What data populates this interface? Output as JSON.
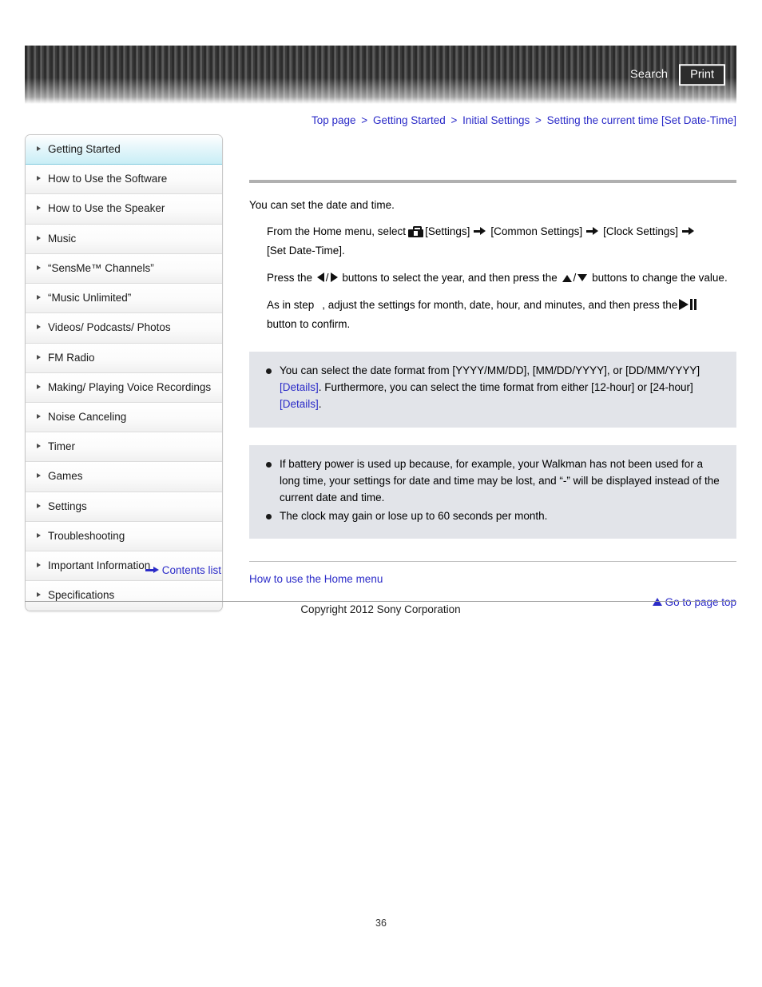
{
  "header": {
    "search_label": "Search",
    "print_label": "Print"
  },
  "breadcrumb": {
    "separator": ">",
    "items": [
      {
        "label": "Top page"
      },
      {
        "label": "Getting Started"
      },
      {
        "label": "Initial Settings"
      },
      {
        "label": "Setting the current time [Set Date-Time]"
      }
    ]
  },
  "sidebar": {
    "items": [
      {
        "label": "Getting Started",
        "selected": true
      },
      {
        "label": "How to Use the Software",
        "selected": false
      },
      {
        "label": "How to Use the Speaker",
        "selected": false
      },
      {
        "label": "Music",
        "selected": false
      },
      {
        "label": "“SensMe™ Channels”",
        "selected": false
      },
      {
        "label": "“Music Unlimited”",
        "selected": false
      },
      {
        "label": "Videos/ Podcasts/ Photos",
        "selected": false
      },
      {
        "label": "FM Radio",
        "selected": false
      },
      {
        "label": "Making/ Playing Voice Recordings",
        "selected": false
      },
      {
        "label": "Noise Canceling",
        "selected": false
      },
      {
        "label": "Timer",
        "selected": false
      },
      {
        "label": "Games",
        "selected": false
      },
      {
        "label": "Settings",
        "selected": false
      },
      {
        "label": "Troubleshooting",
        "selected": false
      },
      {
        "label": "Important Information",
        "selected": false
      },
      {
        "label": "Specifications",
        "selected": false
      }
    ],
    "contents_list_label": "Contents list"
  },
  "main": {
    "intro": "You can set the date and time.",
    "step1": {
      "part1": "From the Home menu, select",
      "settings_bracket": "[Settings]",
      "common_settings_bracket": "[Common Settings]",
      "clock_settings_bracket": "[Clock Settings]",
      "set_date_time_bracket": "[Set Date-Time]."
    },
    "step2": {
      "part1": "Press the",
      "part2": "buttons to select the year, and then press the",
      "part3": "buttons to change the value.",
      "slash": "/"
    },
    "step3": {
      "part1": "As in step",
      "part2": ", adjust the settings for month, date, hour, and minutes, and then press the",
      "part3": "button to confirm."
    },
    "note_box_1": {
      "bullets": [
        {
          "text_a": "You can select the date format from [YYYY/MM/DD], [MM/DD/YYYY], or [DD/MM/YYYY]",
          "link_a": "[Details]",
          "text_b": ". Furthermore, you can select the time format from either [12-hour] or [24-hour]",
          "link_b": "[Details]",
          "text_c": "."
        }
      ]
    },
    "note_box_2": {
      "bullets": [
        "If battery power is used up because, for example, your Walkman has not been used for a long time, your settings for date and time may be lost, and “-” will be displayed instead of the current date and time.",
        "The clock may gain or lose up to 60 seconds per month."
      ]
    },
    "related_link": "How to use the Home menu",
    "page_top_label": "Go to page top"
  },
  "footer": {
    "copyright": "Copyright 2012 Sony Corporation",
    "page_number": "36"
  }
}
